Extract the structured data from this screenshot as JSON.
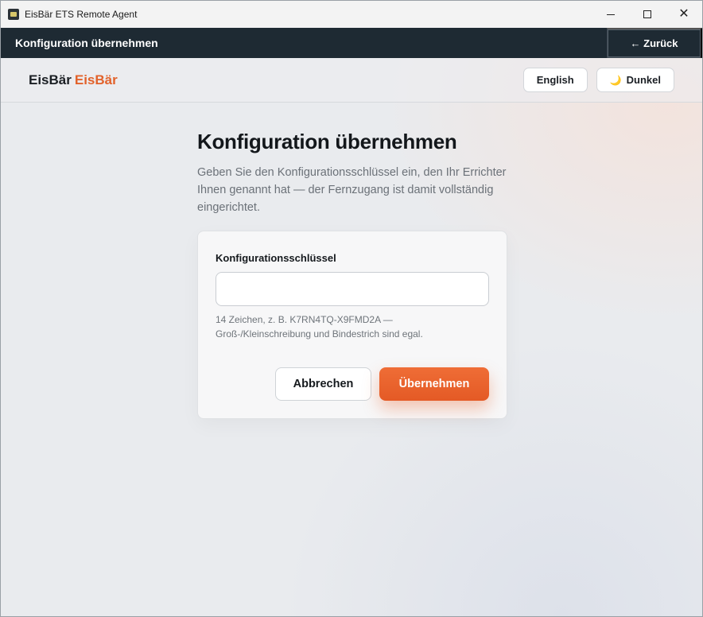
{
  "window": {
    "title": "EisBär ETS Remote Agent",
    "controls": {
      "minimize": "",
      "maximize": "",
      "close": "✕"
    }
  },
  "appbar": {
    "title": "Konfiguration übernehmen",
    "back_label": "← Zurück"
  },
  "subheader": {
    "brand_primary": "EisBär",
    "brand_accent": "EisBär",
    "language_label": "English",
    "theme_icon": "moon-icon",
    "theme_label": "Dunkel"
  },
  "main": {
    "title": "Konfiguration übernehmen",
    "description": "Geben Sie den Konfigurationsschlüssel ein, den Ihr Errichter Ihnen genannt hat — der Fernzugang ist damit vollständig eingerichtet."
  },
  "form": {
    "field_label": "Konfigurationsschlüssel",
    "input_value": "",
    "input_placeholder": "",
    "hint_line1": "14 Zeichen, z. B. K7RN4TQ-X9FMD2A —",
    "hint_line2": "Groß-/Kleinschreibung und Bindestrich sind egal.",
    "cancel_label": "Abbrechen",
    "apply_label": "Übernehmen"
  },
  "colors": {
    "accent": "#e2622b",
    "appbar_bg": "#1e2a33",
    "page_bg": "#e9ebee"
  }
}
